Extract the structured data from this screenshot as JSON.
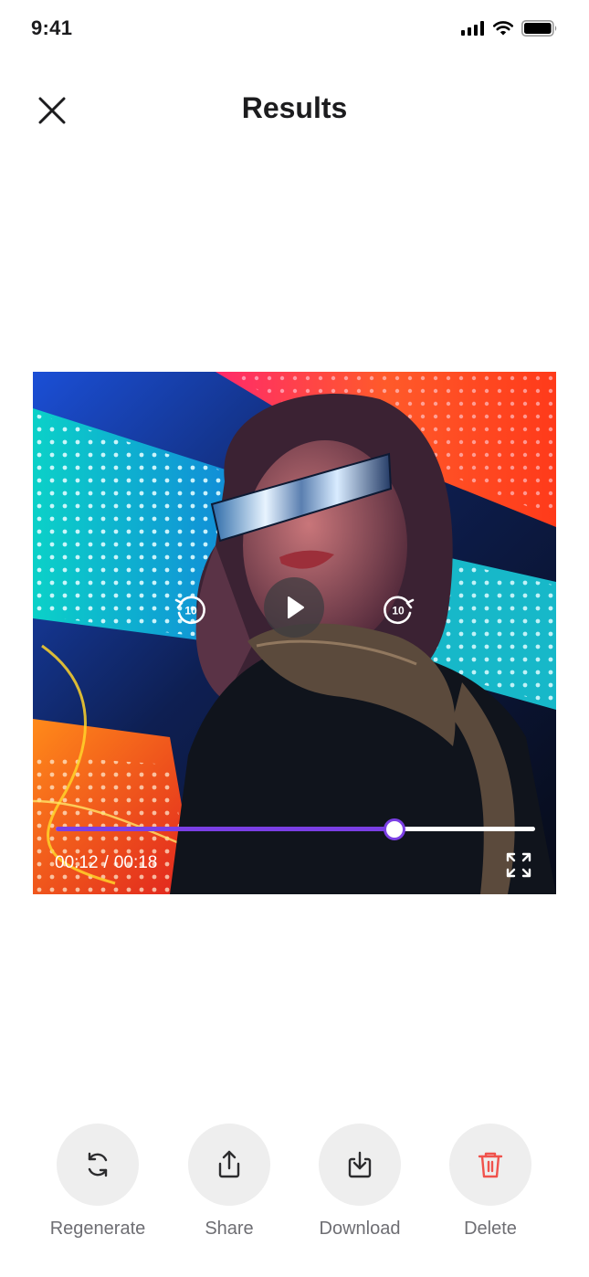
{
  "status_bar": {
    "time": "9:41"
  },
  "header": {
    "title": "Results"
  },
  "player": {
    "current_time": "00:12",
    "separator": "/",
    "duration": "00:18",
    "progress": 0.704,
    "rewind_seconds": "10",
    "forward_seconds": "10"
  },
  "actions": [
    {
      "label": "Regenerate",
      "icon": "refresh-icon"
    },
    {
      "label": "Share",
      "icon": "share-icon"
    },
    {
      "label": "Download",
      "icon": "download-icon"
    },
    {
      "label": "Delete",
      "icon": "trash-icon",
      "color": "#f0524c"
    }
  ],
  "colors": {
    "accent": "#7b3fe4",
    "danger": "#f0524c",
    "action_bg": "#eeeeee"
  }
}
